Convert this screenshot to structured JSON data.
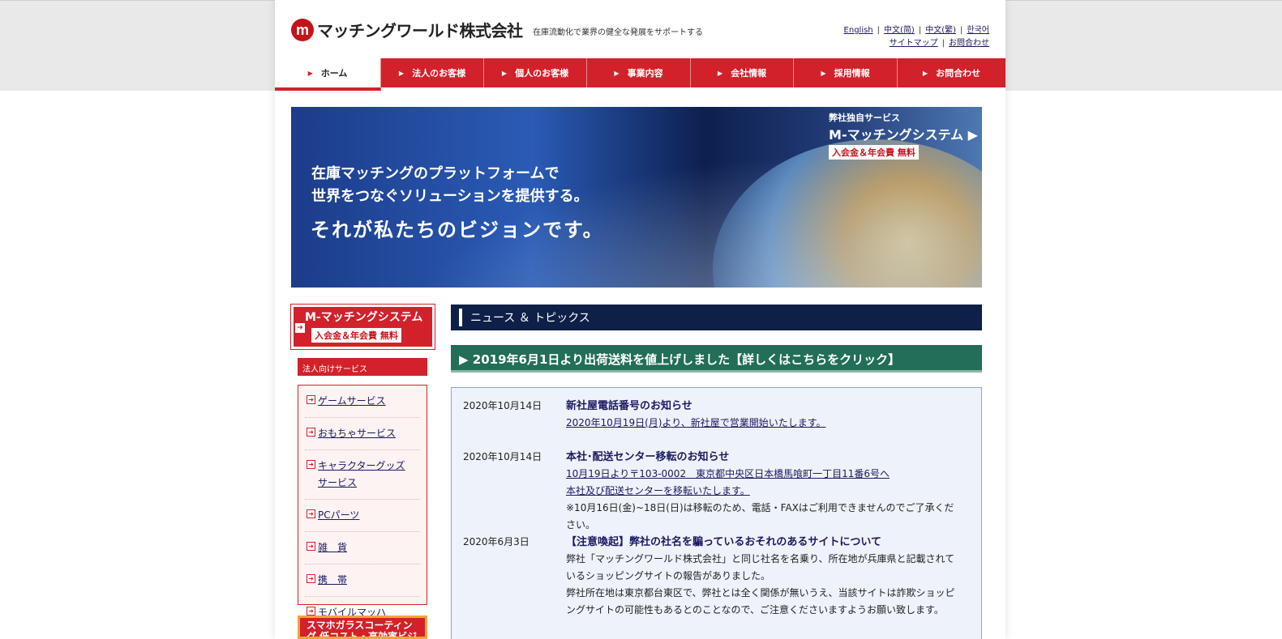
{
  "header": {
    "logo_mark": "m",
    "logo_text": "マッチングワールド株式会社",
    "tagline": "在庫流動化で業界の健全な発展をサポートする",
    "util_links_row1": [
      "English",
      "中文(简)",
      "中文(繁)",
      "한국어"
    ],
    "util_links_row2": [
      "サイトマップ",
      "お問合わせ"
    ]
  },
  "nav": {
    "items": [
      "ホーム",
      "法人のお客様",
      "個人のお客様",
      "事業内容",
      "会社情報",
      "採用情報",
      "お問合わせ"
    ],
    "active_index": 0
  },
  "hero": {
    "line1": "在庫マッチングのプラットフォームで",
    "line2": "世界をつなぐソリューションを提供する。",
    "line3": "それが私たちのビジョンです。",
    "badge_small": "弊社独自サービス",
    "badge_title": "M-マッチングシステム ▶",
    "badge_sub": "入会金＆年会費 無料"
  },
  "sidebar": {
    "banner_title": "M-マッチングシステム",
    "banner_sub": "入会金＆年会費 無料",
    "heading": "法人向けサービス",
    "items": [
      {
        "label": "ゲームサービス"
      },
      {
        "label": "おもちゃサービス"
      },
      {
        "label": "キャラクターグッズ",
        "label2": "サービス"
      },
      {
        "label": "PCパーツ"
      },
      {
        "label": "雑　貨"
      },
      {
        "label": "携　帯"
      },
      {
        "label": "モバイルマッハ"
      }
    ],
    "banner2": "スマホガラスコーティング 低コスト・高効率ビジネス"
  },
  "news": {
    "heading": "ニュース ＆ トピックス",
    "notice": "▶ 2019年6月1日より出荷送料を値上げしました【詳しくはこちらをクリック】",
    "items": [
      {
        "date": "2020年10月14日",
        "title": "新社屋電話番号のお知らせ",
        "link1": "2020年10月19日(月)より、新社屋で営業開始いたします。"
      },
      {
        "date": "2020年10月14日",
        "title": "本社･配送センター移転のお知らせ",
        "link1": "10月19日より〒103-0002　東京都中央区日本橋馬喰町一丁目11番6号へ",
        "link2": "本社及び配送センターを移転いたします。",
        "text1": "※10月16日(金)~18日(日)は移転のため、電話・FAXはご利用できませんのでご了承くだ",
        "text2": "さい。"
      },
      {
        "date": "2020年6月3日",
        "title": "【注意喚起】弊社の社名を騙っているおそれのあるサイトについて",
        "text1": "弊社「マッチングワールド株式会社」と同じ社名を名乗り、所在地が兵庫県と記載されて",
        "text2": "いるショッピングサイトの報告がありました。",
        "text3": "弊社所在地は東京都台東区で、弊社とは全く関係が無いうえ、当該サイトは詐欺ショッピ",
        "text4": "ングサイトの可能性もあるとのことなので、ご注意くださいますようお願い致します。"
      }
    ]
  },
  "colors": {
    "brand_red": "#d3212b",
    "navy": "#0e2048",
    "green": "#226e58",
    "link": "#1a1a60"
  }
}
